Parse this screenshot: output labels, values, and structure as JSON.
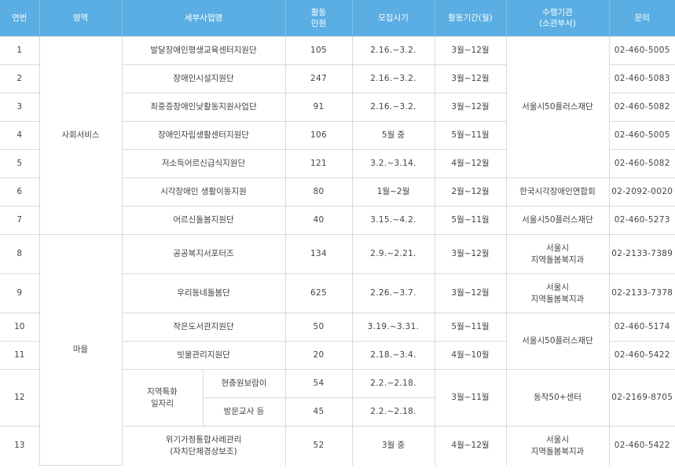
{
  "headers": {
    "no": "연번",
    "area": "영역",
    "project": "세부사업명",
    "people": "활동\n인원",
    "recruit": "모집시기",
    "period": "활동기간(월)",
    "agency": "수행기관\n(소관부서)",
    "contact": "문의"
  },
  "areas": {
    "social": "사회서비스",
    "village": "마을"
  },
  "rows": [
    {
      "no": "1",
      "project": "발달장애인평생교육센터지원단",
      "people": "105",
      "recruit": "2.16.~3.2.",
      "period": "3월~12월",
      "contact": "02-460-5005"
    },
    {
      "no": "2",
      "project": "장애인시설지원단",
      "people": "247",
      "recruit": "2.16.~3.2.",
      "period": "3월~12월",
      "contact": "02-460-5083"
    },
    {
      "no": "3",
      "project": "최중증장애인낮활동지원사업단",
      "people": "91",
      "recruit": "2.16.~3.2.",
      "period": "3월~12월",
      "contact": "02-460-5082"
    },
    {
      "no": "4",
      "project": "장애인자립생활센터지원단",
      "people": "106",
      "recruit": "5월 중",
      "period": "5월~11월",
      "contact": "02-460-5005"
    },
    {
      "no": "5",
      "project": "저소득어르신급식지원단",
      "people": "121",
      "recruit": "3.2.~3.14.",
      "period": "4월~12월",
      "contact": "02-460-5082"
    },
    {
      "no": "6",
      "project": "시각장애인 생활이동지원",
      "people": "80",
      "recruit": "1월~2월",
      "period": "2월~12월",
      "agency": "한국시각장애인연합회",
      "contact": "02-2092-0020"
    },
    {
      "no": "7",
      "project": "어르신돌봄지원단",
      "people": "40",
      "recruit": "3.15.~4.2.",
      "period": "5월~11월",
      "agency": "서울시50플러스재단",
      "contact": "02-460-5273"
    },
    {
      "no": "8",
      "project": "공공복지서포터즈",
      "people": "134",
      "recruit": "2.9.~2.21.",
      "period": "3월~12월",
      "agency": "서울시\n지역돌봄복지과",
      "contact": "02-2133-7389"
    },
    {
      "no": "9",
      "project": "우리동네돌봄단",
      "people": "625",
      "recruit": "2.26.~3.7.",
      "period": "3월~12월",
      "agency": "서울시\n지역돌봄복지과",
      "contact": "02-2133-7378"
    },
    {
      "no": "10",
      "project": "작은도서관지원단",
      "people": "50",
      "recruit": "3.19.~3.31.",
      "period": "5월~11월",
      "contact": "02-460-5174"
    },
    {
      "no": "11",
      "project": "빗물관리지원단",
      "people": "20",
      "recruit": "2.18.~3.4.",
      "period": "4월~10월",
      "contact": "02-460-5422"
    },
    {
      "no": "12",
      "project_group": "지역특화\n일자리",
      "sub": [
        {
          "project": "현충원보람이",
          "people": "54",
          "recruit": "2.2.~2.18."
        },
        {
          "project": "방문교사 등",
          "people": "45",
          "recruit": "2.2.~2.18."
        }
      ],
      "period": "3월~11월",
      "agency": "동작50+센터",
      "contact": "02-2169-8705"
    },
    {
      "no": "13",
      "project": "위기가정통합사례관리\n(자치단체경상보조)",
      "people": "52",
      "recruit": "3월 중",
      "period": "4월~12월",
      "agency": "서울시\n지역돌봄복지과",
      "contact": "02-460-5422"
    }
  ],
  "merged_agency": {
    "rows_1_5": "서울시50플러스재단",
    "rows_10_11": "서울시50플러스재단"
  }
}
